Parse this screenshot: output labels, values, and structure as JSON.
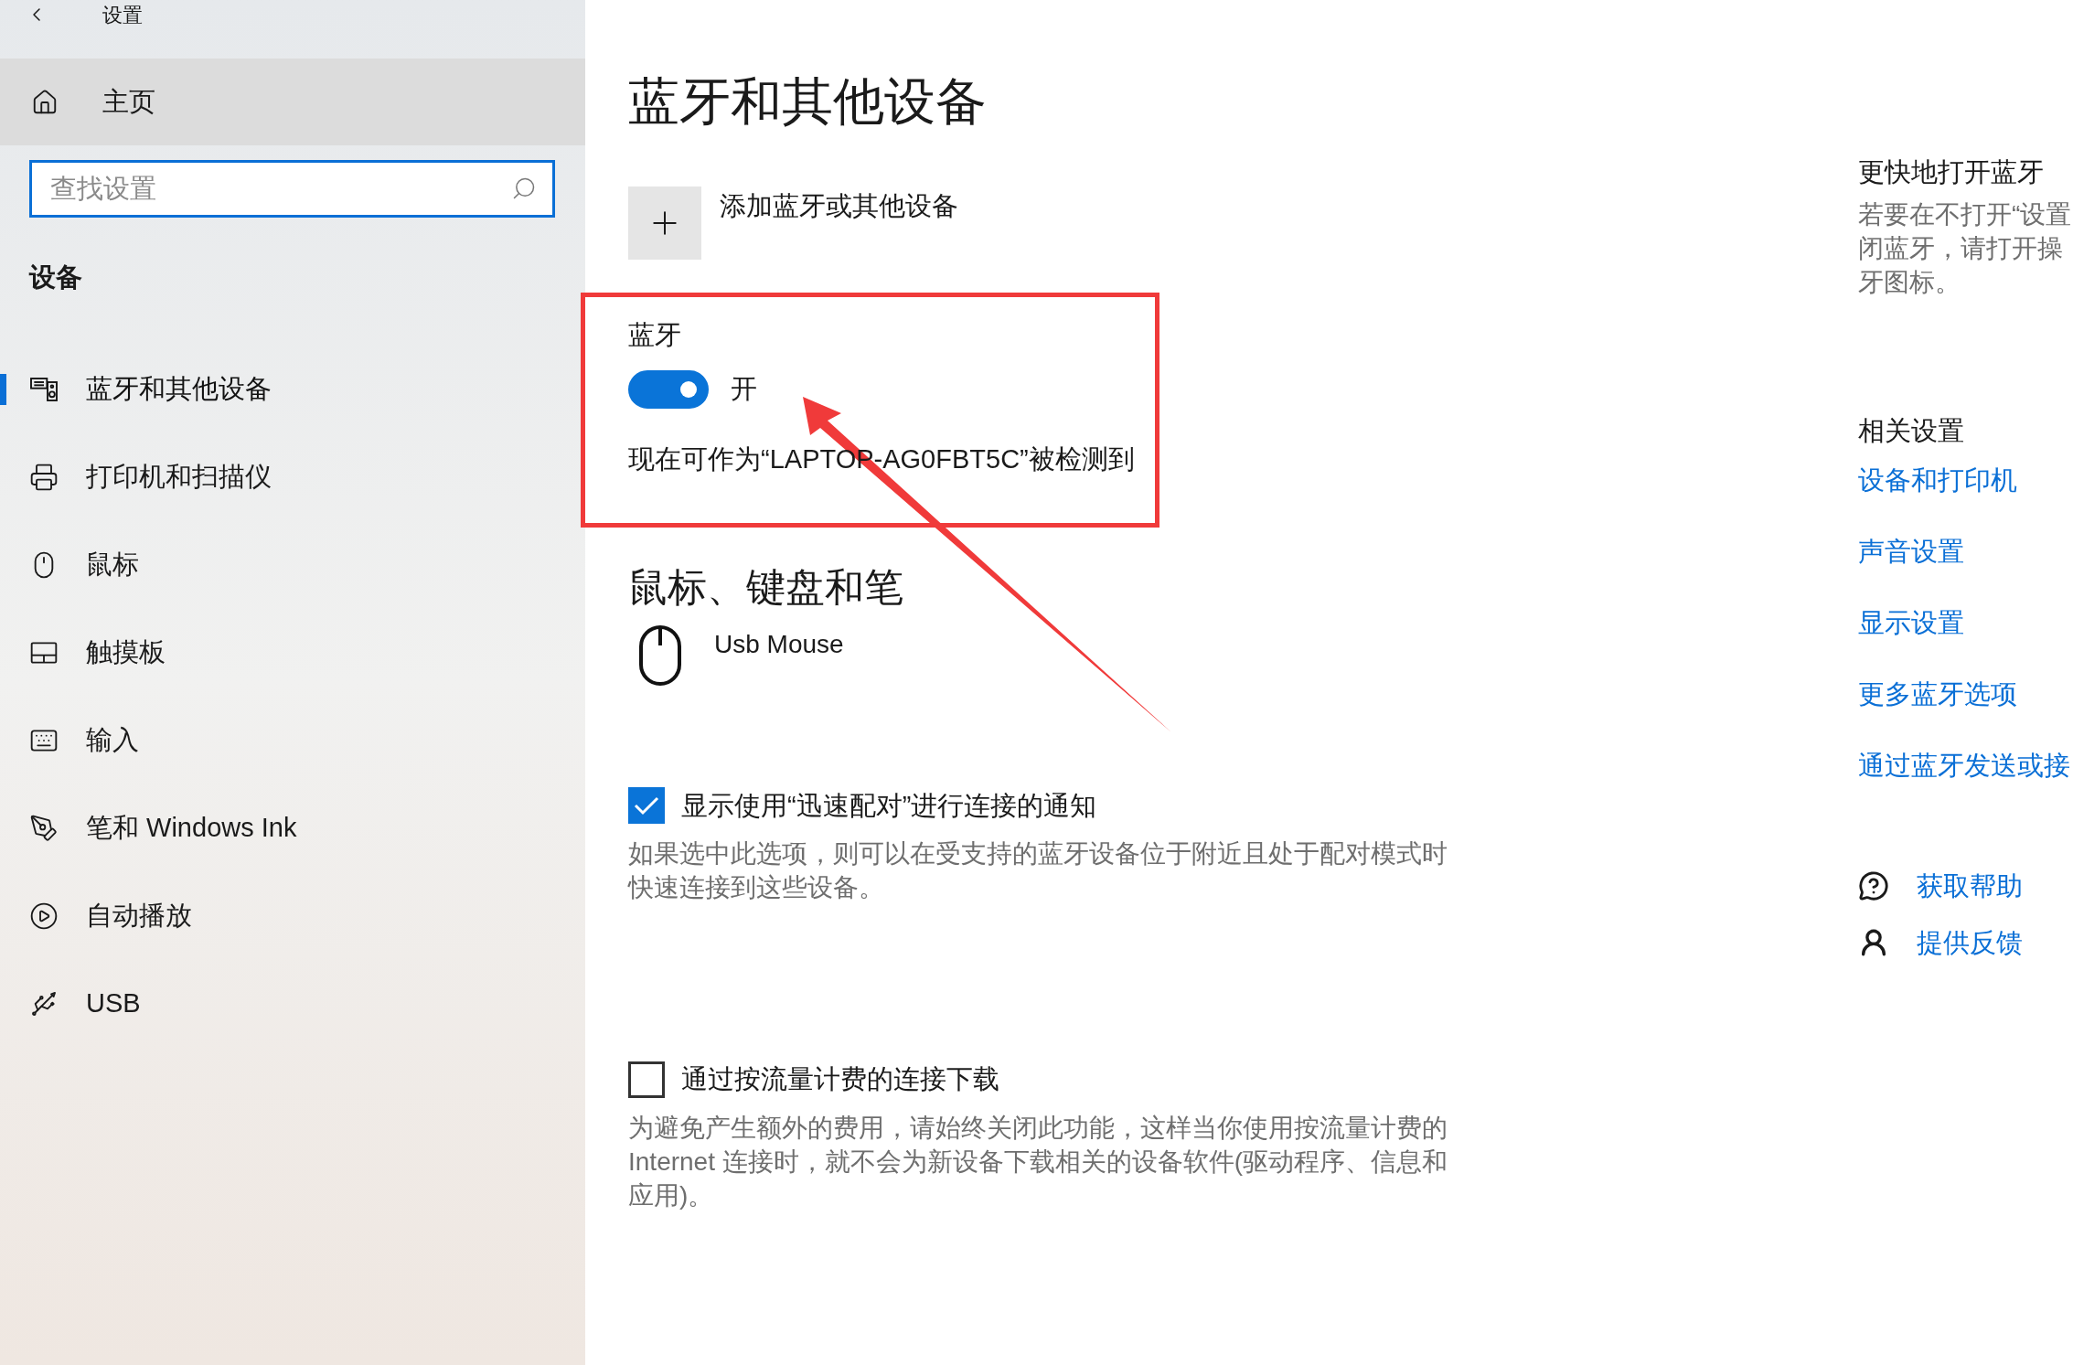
{
  "window": {
    "title": "设置"
  },
  "sidebar": {
    "home": "主页",
    "search": {
      "placeholder": "查找设置"
    },
    "section": "设备",
    "items": [
      {
        "label": "蓝牙和其他设备",
        "selected": true
      },
      {
        "label": "打印机和扫描仪",
        "selected": false
      },
      {
        "label": "鼠标",
        "selected": false
      },
      {
        "label": "触摸板",
        "selected": false
      },
      {
        "label": "输入",
        "selected": false
      },
      {
        "label": "笔和 Windows Ink",
        "selected": false
      },
      {
        "label": "自动播放",
        "selected": false
      },
      {
        "label": "USB",
        "selected": false
      }
    ]
  },
  "main": {
    "title": "蓝牙和其他设备",
    "add_device": "添加蓝牙或其他设备",
    "bluetooth": {
      "label": "蓝牙",
      "on": true,
      "state_text": "开",
      "status": "现在可作为“LAPTOP-AG0FBT5C”被检测到"
    },
    "mouse_section": {
      "heading": "鼠标、键盘和笔",
      "devices": [
        {
          "name": "Usb Mouse"
        }
      ]
    },
    "options": [
      {
        "label": "显示使用“迅速配对”进行连接的通知",
        "checked": true,
        "description": "如果选中此选项，则可以在受支持的蓝牙设备位于附近且处于配对模式时快速连接到这些设备。"
      },
      {
        "label": "通过按流量计费的连接下载",
        "checked": false,
        "description": "为避免产生额外的费用，请始终关闭此功能，这样当你使用按流量计费的 Internet 连接时，就不会为新设备下载相关的设备软件(驱动程序、信息和应用)。"
      }
    ]
  },
  "right": {
    "quick": {
      "heading": "更快地打开蓝牙",
      "lines": [
        "若要在不打开“设置",
        "闭蓝牙，请打开操",
        "牙图标。"
      ]
    },
    "related": {
      "heading": "相关设置",
      "links": [
        "设备和打印机",
        "声音设置",
        "显示设置",
        "更多蓝牙选项",
        "通过蓝牙发送或接"
      ]
    },
    "support": [
      "获取帮助",
      "提供反馈"
    ]
  }
}
